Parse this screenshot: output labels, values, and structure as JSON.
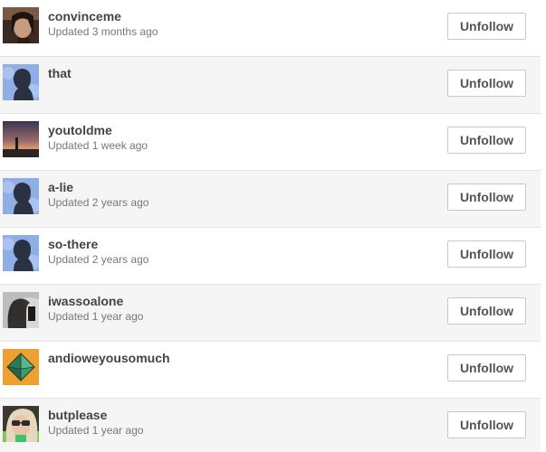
{
  "following": [
    {
      "name": "convinceme",
      "updated": "Updated 3 months ago",
      "avatar": "photo-avatar",
      "button": "Unfollow"
    },
    {
      "name": "that",
      "updated": "",
      "avatar": "default-silhouette-avatar",
      "button": "Unfollow"
    },
    {
      "name": "youtoldme",
      "updated": "Updated 1 week ago",
      "avatar": "sunset-photo-avatar",
      "button": "Unfollow"
    },
    {
      "name": "a-lie",
      "updated": "Updated 2 years ago",
      "avatar": "default-silhouette-avatar",
      "button": "Unfollow"
    },
    {
      "name": "so-there",
      "updated": "Updated 2 years ago",
      "avatar": "default-silhouette-avatar",
      "button": "Unfollow"
    },
    {
      "name": "iwassoalone",
      "updated": "Updated 1 year ago",
      "avatar": "photo-avatar",
      "button": "Unfollow"
    },
    {
      "name": "andioweyousomuch",
      "updated": "",
      "avatar": "geometric-avatar",
      "button": "Unfollow"
    },
    {
      "name": "butplease",
      "updated": "Updated 1 year ago",
      "avatar": "photo-avatar",
      "button": "Unfollow"
    }
  ],
  "colors": {
    "row_alt_background": "#f5f5f5",
    "default_avatar_blue": "#8faee6",
    "silhouette": "#2a3140",
    "geometric_avatar_orange": "#f0a030",
    "geometric_avatar_green": "#3f9a6e"
  }
}
